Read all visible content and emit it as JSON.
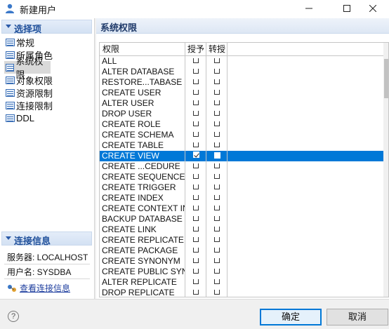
{
  "window": {
    "title": "新建用户",
    "icon": "user-icon"
  },
  "left_panel": {
    "section_title": "选择项",
    "items": [
      {
        "label": "常规"
      },
      {
        "label": "所属角色"
      },
      {
        "label": "系统权限",
        "selected": true
      },
      {
        "label": "对象权限"
      },
      {
        "label": "资源限制"
      },
      {
        "label": "连接限制"
      },
      {
        "label": "DDL"
      }
    ],
    "conn_title": "连接信息",
    "server": "服务器: LOCALHOST",
    "user": "用户名: SYSDBA",
    "view_link": "查看连接信息"
  },
  "right_panel": {
    "title": "系统权限",
    "columns": [
      "权限",
      "授予",
      "转授"
    ],
    "rows": [
      {
        "name": "ALL",
        "grant": false,
        "transfer": false
      },
      {
        "name": "ALTER DATABASE",
        "grant": false,
        "transfer": false
      },
      {
        "name": "RESTORE...TABASE",
        "grant": false,
        "transfer": false
      },
      {
        "name": "CREATE USER",
        "grant": false,
        "transfer": false
      },
      {
        "name": "ALTER USER",
        "grant": false,
        "transfer": false
      },
      {
        "name": "DROP USER",
        "grant": false,
        "transfer": false
      },
      {
        "name": "CREATE ROLE",
        "grant": false,
        "transfer": false
      },
      {
        "name": "CREATE SCHEMA",
        "grant": false,
        "transfer": false
      },
      {
        "name": "CREATE TABLE",
        "grant": false,
        "transfer": false
      },
      {
        "name": "CREATE VIEW",
        "grant": true,
        "transfer": false,
        "selected": true
      },
      {
        "name": "CREATE ...CEDURE",
        "grant": false,
        "transfer": false
      },
      {
        "name": "CREATE SEQUENCE",
        "grant": false,
        "transfer": false
      },
      {
        "name": "CREATE TRIGGER",
        "grant": false,
        "transfer": false
      },
      {
        "name": "CREATE INDEX",
        "grant": false,
        "transfer": false
      },
      {
        "name": "CREATE CONTEXT IN",
        "grant": false,
        "transfer": false
      },
      {
        "name": "BACKUP DATABASE",
        "grant": false,
        "transfer": false
      },
      {
        "name": "CREATE LINK",
        "grant": false,
        "transfer": false
      },
      {
        "name": "CREATE REPLICATE",
        "grant": false,
        "transfer": false
      },
      {
        "name": "CREATE PACKAGE",
        "grant": false,
        "transfer": false
      },
      {
        "name": "CREATE SYNONYM",
        "grant": false,
        "transfer": false
      },
      {
        "name": "CREATE PUBLIC SYNC",
        "grant": false,
        "transfer": false
      },
      {
        "name": "ALTER REPLICATE",
        "grant": false,
        "transfer": false
      },
      {
        "name": "DROP REPLICATE",
        "grant": false,
        "transfer": false
      }
    ]
  },
  "buttons": {
    "ok": "确定",
    "cancel": "取消",
    "help": "?"
  },
  "colors": {
    "selection": "#0078d7",
    "section_header": "#d3e1f3",
    "link": "#1f3f9f"
  }
}
